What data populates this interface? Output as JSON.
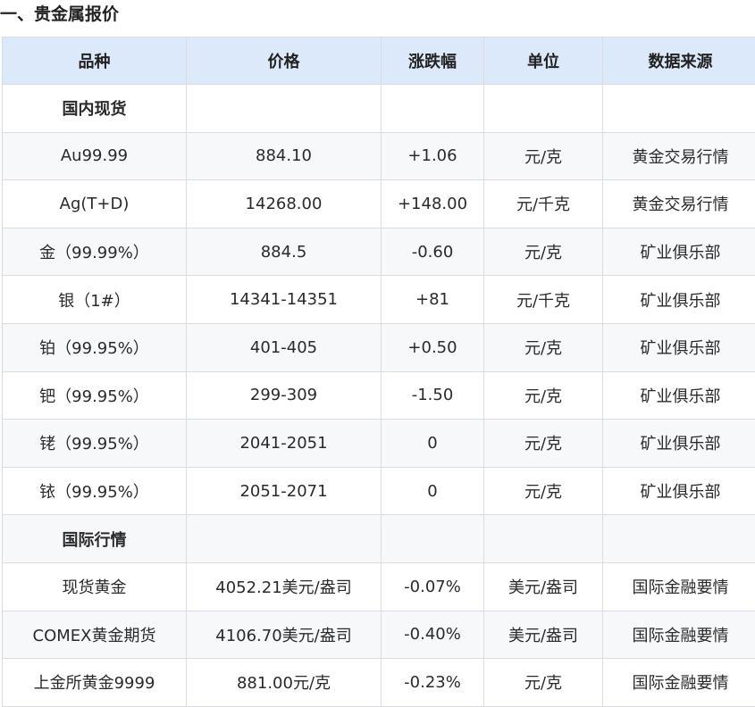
{
  "section_title": "一、贵金属报价",
  "headers": [
    "品种",
    "价格",
    "涨跌幅",
    "单位",
    "数据来源"
  ],
  "rows": [
    {
      "type": "group",
      "label": "国内现货"
    },
    {
      "type": "data",
      "cells": [
        "Au99.99",
        "884.10",
        "+1.06",
        "元/克",
        "黄金交易行情"
      ]
    },
    {
      "type": "data",
      "cells": [
        "Ag(T+D)",
        "14268.00",
        "+148.00",
        "元/千克",
        "黄金交易行情"
      ]
    },
    {
      "type": "data",
      "cells": [
        "金（99.99%）",
        "884.5",
        "-0.60",
        "元/克",
        "矿业俱乐部"
      ]
    },
    {
      "type": "data",
      "cells": [
        "银（1#）",
        "14341-14351",
        "+81",
        "元/千克",
        "矿业俱乐部"
      ]
    },
    {
      "type": "data",
      "cells": [
        "铂（99.95%）",
        "401-405",
        "+0.50",
        "元/克",
        "矿业俱乐部"
      ]
    },
    {
      "type": "data",
      "cells": [
        "钯（99.95%）",
        "299-309",
        "-1.50",
        "元/克",
        "矿业俱乐部"
      ]
    },
    {
      "type": "data",
      "cells": [
        "铑（99.95%）",
        "2041-2051",
        "0",
        "元/克",
        "矿业俱乐部"
      ]
    },
    {
      "type": "data",
      "cells": [
        "铱（99.95%）",
        "2051-2071",
        "0",
        "元/克",
        "矿业俱乐部"
      ]
    },
    {
      "type": "group",
      "label": "国际行情"
    },
    {
      "type": "data",
      "cells": [
        "现货黄金",
        "4052.21美元/盎司",
        "-0.07%",
        "美元/盎司",
        "国际金融要情"
      ]
    },
    {
      "type": "data",
      "cells": [
        "COMEX黄金期货",
        "4106.70美元/盎司",
        "-0.40%",
        "美元/盎司",
        "国际金融要情"
      ]
    },
    {
      "type": "data",
      "cells": [
        "上金所黄金9999",
        "881.00元/克",
        "-0.23%",
        "元/克",
        "国际金融要情"
      ]
    }
  ]
}
